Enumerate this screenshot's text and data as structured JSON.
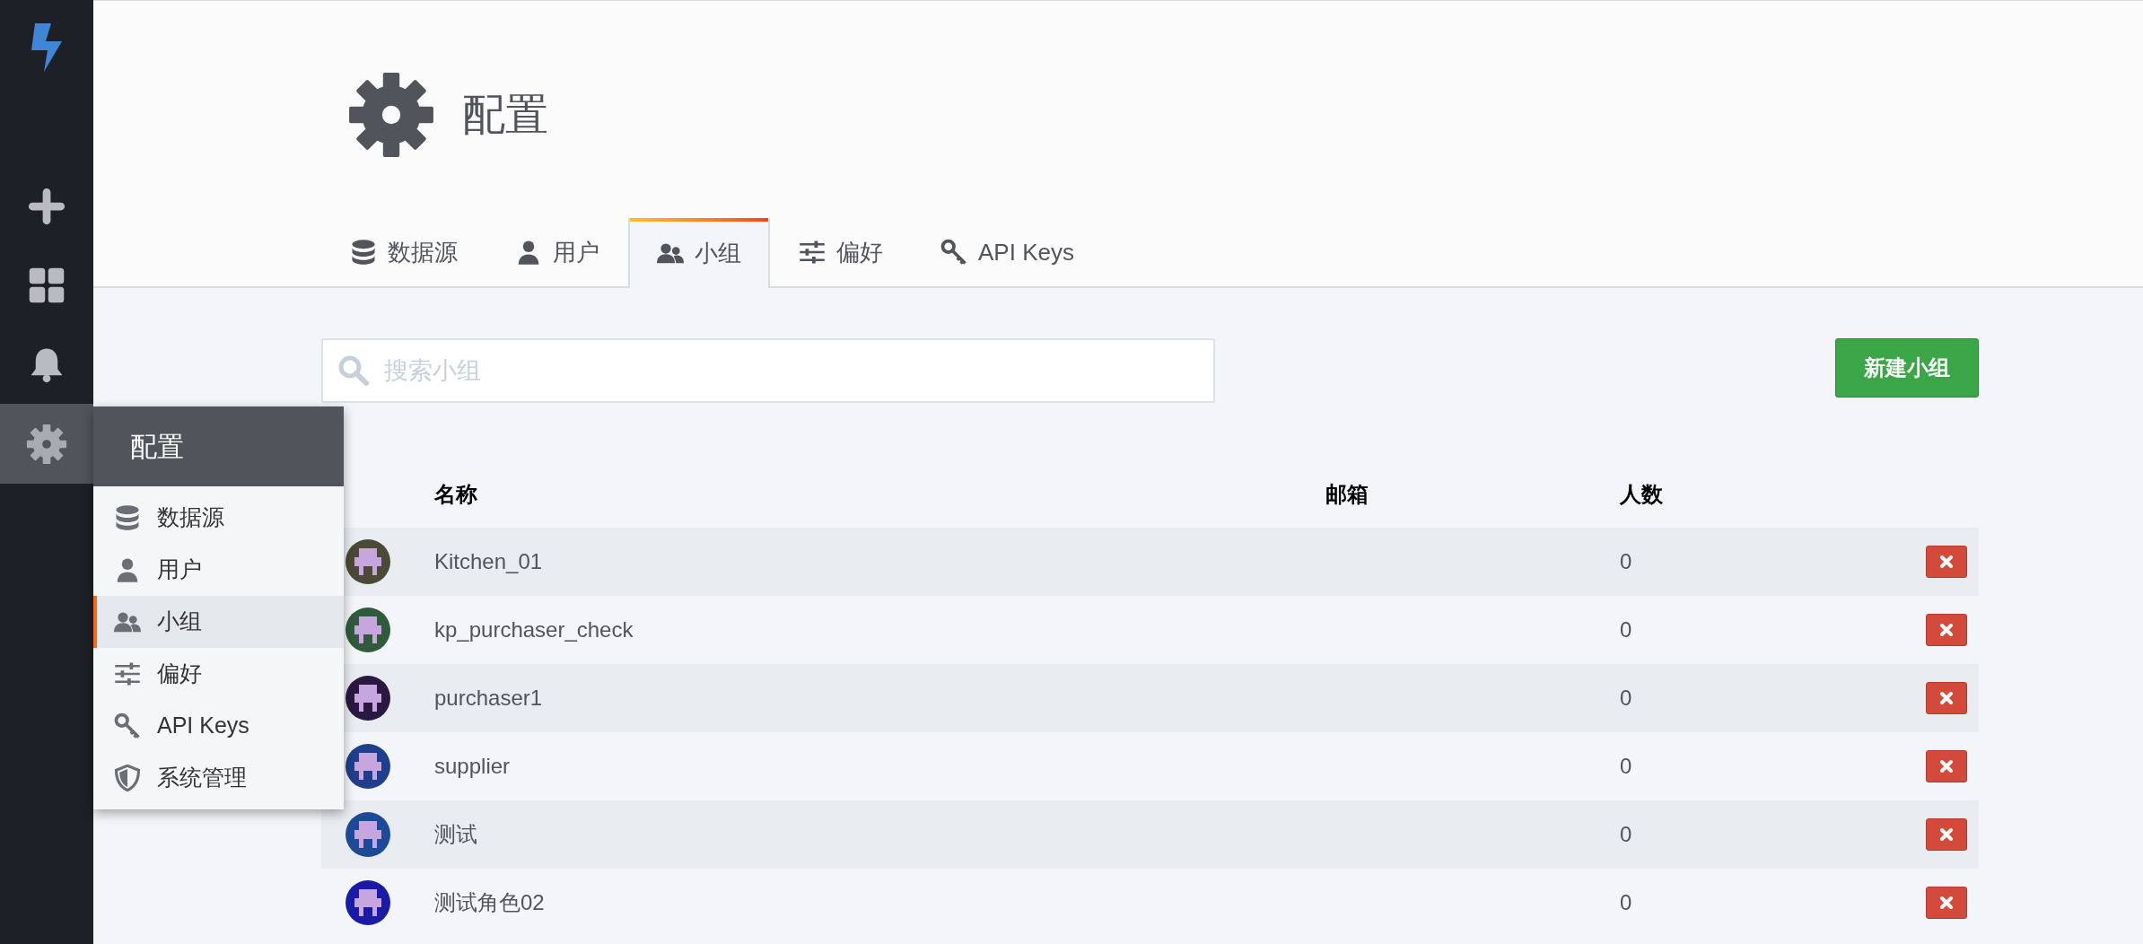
{
  "sidebar": {
    "items": [
      {
        "kind": "plus",
        "selected": false
      },
      {
        "kind": "dashboard",
        "selected": false
      },
      {
        "kind": "bell",
        "selected": false
      },
      {
        "kind": "gear",
        "selected": true
      }
    ]
  },
  "header": {
    "title": "配置"
  },
  "tabs": [
    {
      "label": "数据源",
      "kind": "database",
      "selected": false
    },
    {
      "label": "用户",
      "kind": "user",
      "selected": false
    },
    {
      "label": "小组",
      "kind": "users",
      "selected": true
    },
    {
      "label": "偏好",
      "kind": "sliders",
      "selected": false
    },
    {
      "label": "API Keys",
      "kind": "key",
      "selected": false
    }
  ],
  "search": {
    "placeholder": "搜索小组"
  },
  "new_button": "新建小组",
  "table": {
    "columns": [
      "名称",
      "邮箱",
      "人数"
    ],
    "rows": [
      {
        "name": "Kitchen_01",
        "members": "0",
        "color": "#4a4a36"
      },
      {
        "name": "kp_purchaser_check",
        "members": "0",
        "color": "#2f5a3c"
      },
      {
        "name": "purchaser1",
        "members": "0",
        "color": "#2a1840"
      },
      {
        "name": "supplier",
        "members": "0",
        "color": "#1f3f8c"
      },
      {
        "name": "测试",
        "members": "0",
        "color": "#1c4a96"
      },
      {
        "name": "测试角色02",
        "members": "0",
        "color": "#1a1aa8"
      }
    ]
  },
  "menu": {
    "title": "配置",
    "items": [
      {
        "label": "数据源",
        "kind": "database",
        "selected": false
      },
      {
        "label": "用户",
        "kind": "user",
        "selected": false
      },
      {
        "label": "小组",
        "kind": "users",
        "selected": true
      },
      {
        "label": "偏好",
        "kind": "sliders",
        "selected": false
      },
      {
        "label": "API Keys",
        "kind": "key",
        "selected": false
      },
      {
        "label": "系统管理",
        "kind": "shield",
        "selected": false
      }
    ]
  }
}
